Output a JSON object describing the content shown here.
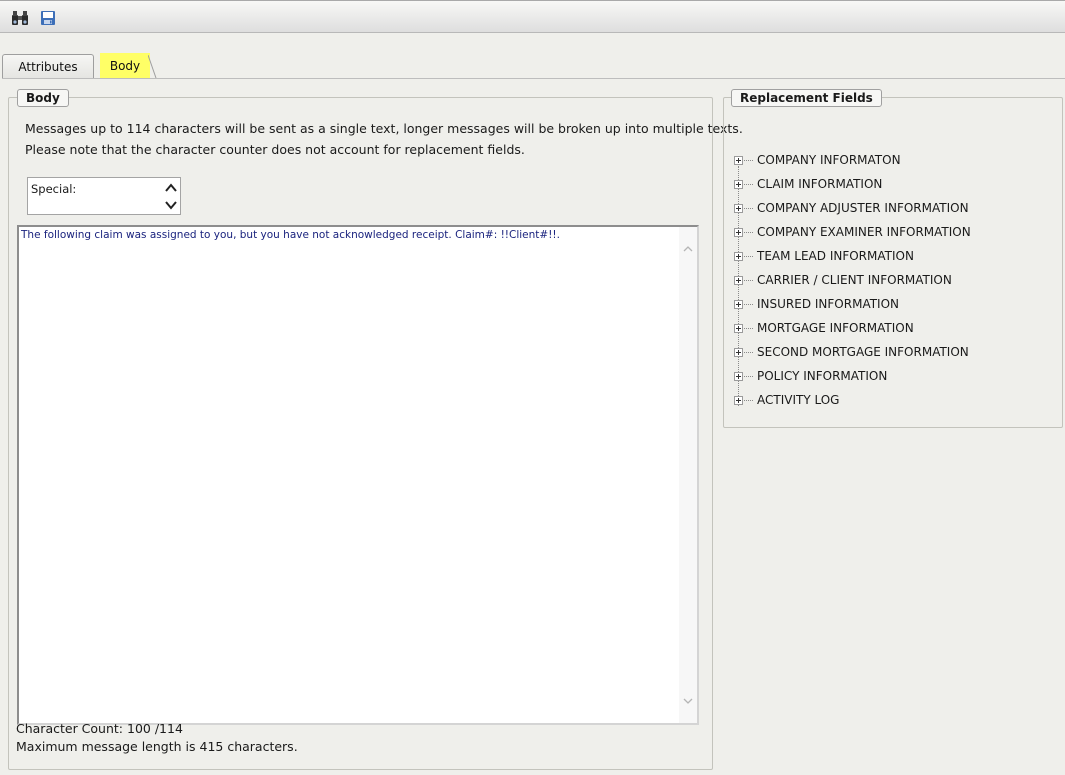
{
  "toolbar": {
    "icons": [
      "binoculars-icon",
      "save-icon"
    ]
  },
  "tabs": [
    {
      "label": "Attributes",
      "active": false
    },
    {
      "label": "Body",
      "active": true
    }
  ],
  "body_group": {
    "legend": "Body",
    "info_line1": "Messages up to 114 characters will be sent as a single text, longer messages will be broken up into multiple texts.",
    "info_line2": "Please note that the character counter does not account for replacement fields.",
    "special": {
      "label": "Special:"
    },
    "editor_text": "The following claim was assigned to you, but you have not acknowledged receipt. Claim#: !!Client#!!.",
    "character_count": "Character Count: 100 /114",
    "max_length": "Maximum message length is 415 characters."
  },
  "replacement_fields": {
    "legend": "Replacement Fields",
    "items": [
      "COMPANY INFORMATON",
      "CLAIM INFORMATION",
      "COMPANY ADJUSTER INFORMATION",
      "COMPANY EXAMINER INFORMATION",
      "TEAM LEAD INFORMATION",
      "CARRIER / CLIENT INFORMATION",
      "INSURED INFORMATION",
      "MORTGAGE INFORMATION",
      "SECOND MORTGAGE INFORMATION",
      "POLICY INFORMATION",
      "ACTIVITY LOG"
    ]
  },
  "colors": {
    "active_tab_highlight": "#ffff66",
    "editor_text": "#1a237e",
    "window_background": "#efefeb"
  }
}
